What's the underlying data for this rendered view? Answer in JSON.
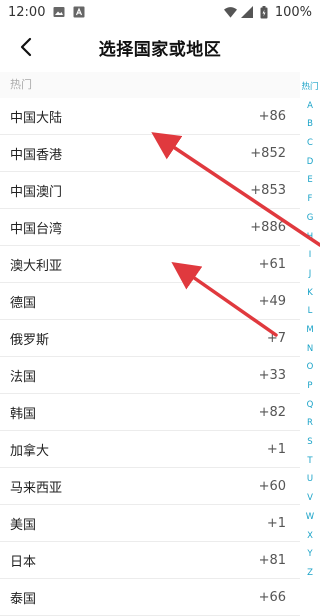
{
  "status_bar": {
    "time": "12:00",
    "battery": "100%",
    "icons": [
      "image-icon",
      "app-notification-icon",
      "wifi-icon",
      "signal-icon",
      "battery-icon"
    ]
  },
  "header": {
    "title": "选择国家或地区",
    "back_icon": "chevron-left-icon"
  },
  "list": {
    "section_label": "热门",
    "rows": [
      {
        "name": "中国大陆",
        "code": "+86"
      },
      {
        "name": "中国香港",
        "code": "+852"
      },
      {
        "name": "中国澳门",
        "code": "+853"
      },
      {
        "name": "中国台湾",
        "code": "+886"
      },
      {
        "name": "澳大利亚",
        "code": "+61"
      },
      {
        "name": "德国",
        "code": "+49"
      },
      {
        "name": "俄罗斯",
        "code": "+7"
      },
      {
        "name": "法国",
        "code": "+33"
      },
      {
        "name": "韩国",
        "code": "+82"
      },
      {
        "name": "加拿大",
        "code": "+1"
      },
      {
        "name": "马来西亚",
        "code": "+60"
      },
      {
        "name": "美国",
        "code": "+1"
      },
      {
        "name": "日本",
        "code": "+81"
      },
      {
        "name": "泰国",
        "code": "+66"
      }
    ]
  },
  "index_bar": [
    "热门",
    "A",
    "B",
    "C",
    "D",
    "E",
    "F",
    "G",
    "H",
    "I",
    "J",
    "K",
    "L",
    "M",
    "N",
    "O",
    "P",
    "Q",
    "R",
    "S",
    "T",
    "U",
    "V",
    "W",
    "X",
    "Y",
    "Z"
  ],
  "colors": {
    "accent": "#1aa3c8",
    "annotation_arrow": "#e0393e"
  }
}
